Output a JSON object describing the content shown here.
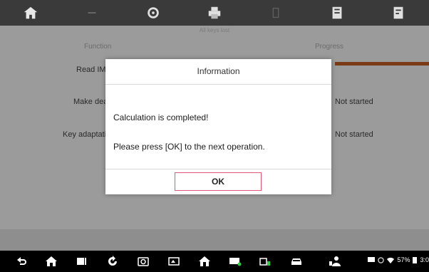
{
  "toolbar": {
    "buttons": [
      "home-icon",
      "back-icon",
      "settings-icon",
      "print-icon",
      "help-icon",
      "save-icon",
      "report-icon"
    ]
  },
  "app": {
    "subtitle": "All keys lost",
    "right_tag": "",
    "col_function": "Function",
    "col_progress": "Progress",
    "rows": [
      {
        "label": "Read IMMO data",
        "status": ""
      },
      {
        "label": "Make dealer key",
        "status": "Not started"
      },
      {
        "label": "Key adaptation",
        "status": "Not started"
      }
    ]
  },
  "dialog": {
    "title": "Information",
    "line1": "Calculation is completed!",
    "line2": "Please press [OK] to the next operation.",
    "ok_label": "OK"
  },
  "status": {
    "battery": "57%",
    "time": "3:0"
  },
  "colors": {
    "progress": "#7a3a16",
    "ok_border": "#e4557a"
  }
}
